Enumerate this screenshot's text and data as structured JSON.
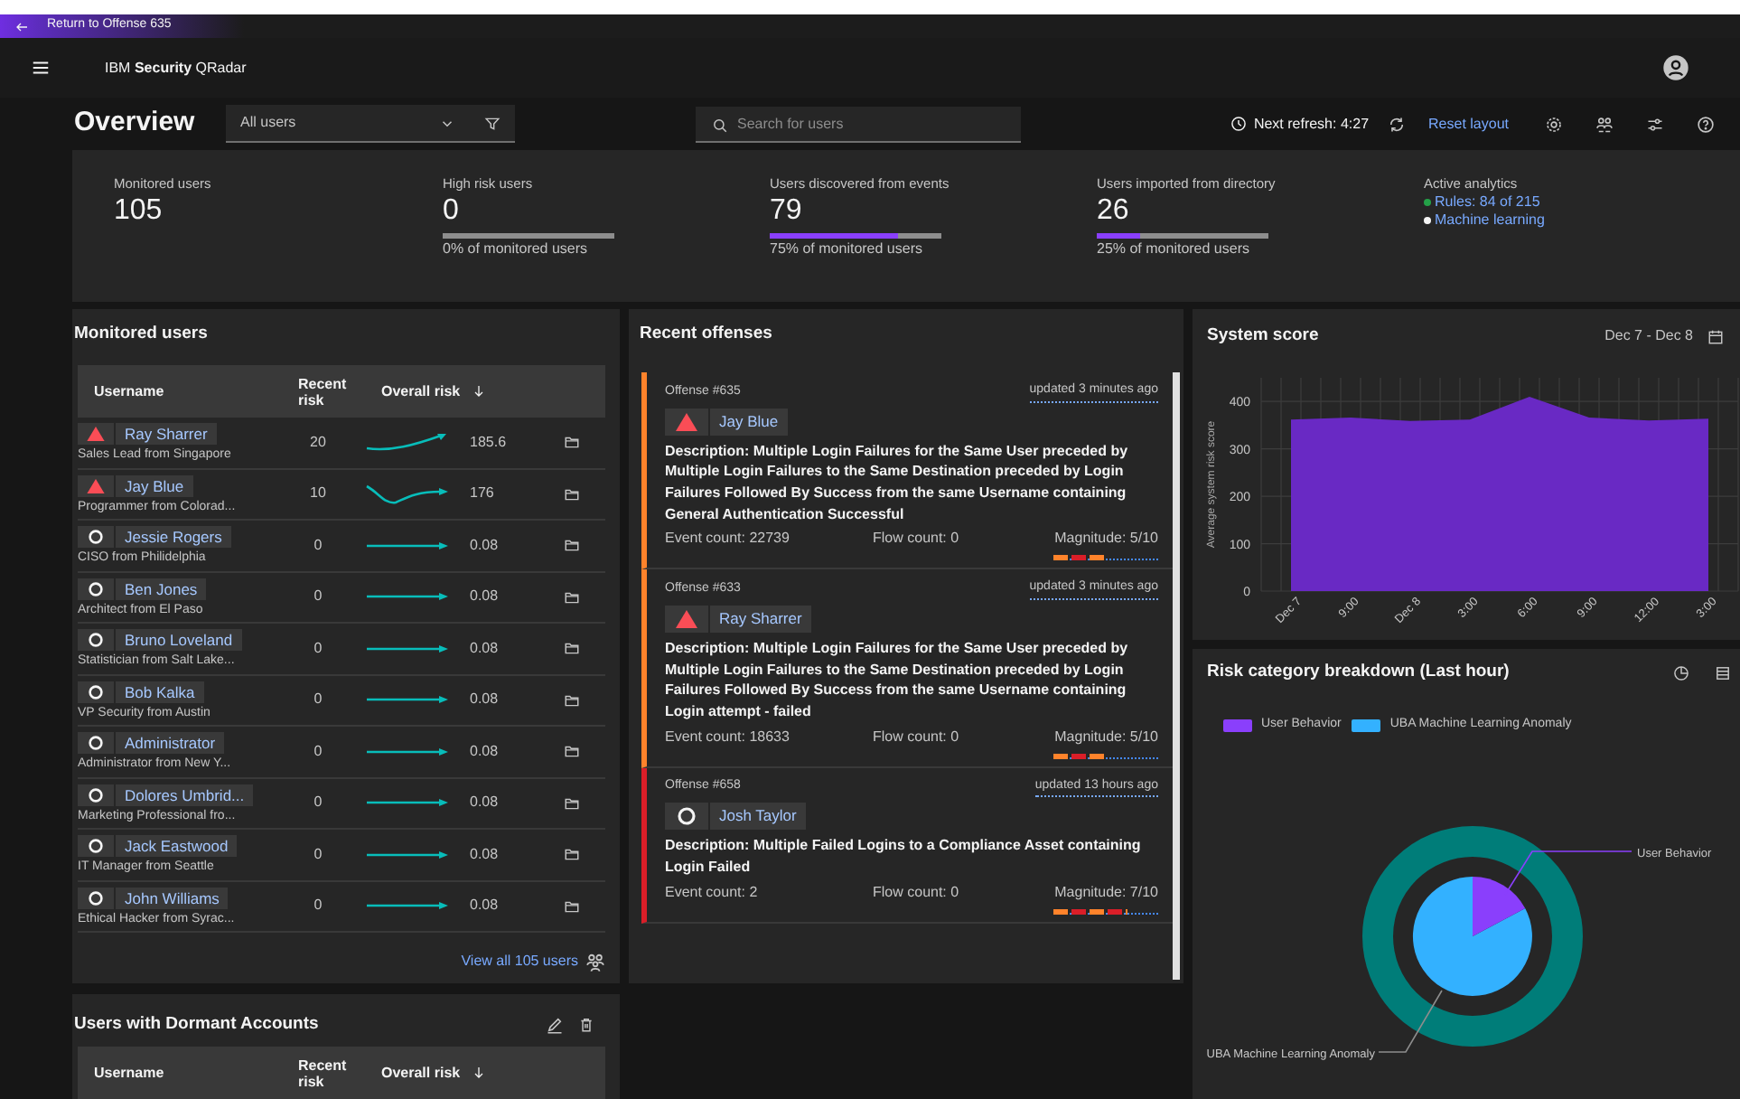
{
  "return_bar": {
    "label": "Return to Offense 635"
  },
  "header": {
    "title": "IBM **Security** QRadar"
  },
  "toolbar": {
    "title": "Overview",
    "filter": {
      "value": "All users"
    },
    "search": {
      "placeholder": "Search for users"
    },
    "refresh": "Next refresh: 4:27",
    "reset": "Reset layout"
  },
  "stats": [
    {
      "label": "Monitored users",
      "value": "105"
    },
    {
      "label": "High risk users",
      "value": "0",
      "caption": "0% of monitored users"
    },
    {
      "label": "Users discovered from events",
      "value": "79",
      "level": 0.75,
      "caption": "75% of monitored users"
    },
    {
      "label": "Users imported from directory",
      "value": "26",
      "level": 0.25,
      "caption": "25% of monitored users"
    }
  ],
  "analytics": {
    "label": "Active analytics",
    "items": [
      {
        "text": "Rules: 84 of 215",
        "color": "#24a148"
      },
      {
        "text": "Machine learning",
        "color": "#f4f4f4"
      }
    ]
  },
  "monitored": {
    "title": "Monitored users",
    "columns": [
      "Username",
      "Recent risk",
      "Overall risk"
    ],
    "rows": [
      {
        "name": "Ray Sharrer",
        "subtitle": "Sales Lead from Singapore",
        "high_risk": true,
        "recent": "20",
        "kind": "rise",
        "overall": "185.6"
      },
      {
        "name": "Jay Blue",
        "subtitle": "Programmer from Colorad...",
        "high_risk": true,
        "recent": "10",
        "kind": "dip",
        "overall": "176"
      },
      {
        "name": "Jessie Rogers",
        "subtitle": "CISO from Philidelphia",
        "high_risk": false,
        "recent": "0",
        "kind": "flat",
        "overall": "0.08"
      },
      {
        "name": "Ben Jones",
        "subtitle": "Architect from El Paso",
        "high_risk": false,
        "recent": "0",
        "kind": "flat",
        "overall": "0.08"
      },
      {
        "name": "Bruno Loveland",
        "subtitle": "Statistician from Salt Lake...",
        "high_risk": false,
        "recent": "0",
        "kind": "flat",
        "overall": "0.08"
      },
      {
        "name": "Bob Kalka",
        "subtitle": "VP Security from Austin",
        "high_risk": false,
        "recent": "0",
        "kind": "flat",
        "overall": "0.08"
      },
      {
        "name": "Administrator",
        "subtitle": "Administrator from New Y...",
        "high_risk": false,
        "recent": "0",
        "kind": "flat",
        "overall": "0.08"
      },
      {
        "name": "Dolores Umbrid...",
        "subtitle": "Marketing Professional fro...",
        "high_risk": false,
        "recent": "0",
        "kind": "flat",
        "overall": "0.08"
      },
      {
        "name": "Jack Eastwood",
        "subtitle": "IT Manager from Seattle",
        "high_risk": false,
        "recent": "0",
        "kind": "flat",
        "overall": "0.08"
      },
      {
        "name": "John Williams",
        "subtitle": "Ethical Hacker from Syrac...",
        "high_risk": false,
        "recent": "0",
        "kind": "flat",
        "overall": "0.08"
      }
    ],
    "view_all": "View all 105 users"
  },
  "dormant": {
    "title": "Users with Dormant Accounts",
    "columns": [
      "Username",
      "Recent risk",
      "Overall risk"
    ]
  },
  "offenses": {
    "title": "Recent offenses",
    "items": [
      {
        "id": "Offense #635",
        "updated": "updated 3 minutes ago",
        "high_risk": true,
        "user": "Jay Blue",
        "description": "Description: Multiple Login Failures for the Same User preceded by Multiple Login Failures to the Same Destination preceded by Login Failures Followed By Success from the same Username containing General Authentication Successful",
        "event_count": "Event count: 22739",
        "flow_count": "Flow count: 0",
        "magnitude": "Magnitude: 5/10",
        "level": 0.5,
        "color": "#ff832b"
      },
      {
        "id": "Offense #633",
        "updated": "updated 3 minutes ago",
        "high_risk": true,
        "user": "Ray Sharrer",
        "description": "Description: Multiple Login Failures for the Same User preceded by Multiple Login Failures to the Same Destination preceded by Login Failures Followed By Success from the same Username containing Login attempt - failed",
        "event_count": "Event count: 18633",
        "flow_count": "Flow count: 0",
        "magnitude": "Magnitude: 5/10",
        "level": 0.5,
        "color": "#ff832b"
      },
      {
        "id": "Offense #658",
        "updated": "updated 13 hours ago",
        "high_risk": false,
        "user": "Josh Taylor",
        "description": "Description: Multiple Failed Logins to a Compliance Asset containing Login Failed",
        "event_count": "Event count: 2",
        "flow_count": "Flow count: 0",
        "magnitude": "Magnitude: 7/10",
        "level": 0.7,
        "color": "#da1e28"
      }
    ]
  },
  "system_score": {
    "title": "System score",
    "range": "Dec 7 - Dec 8",
    "chart_data": {
      "type": "area",
      "ylabel": "Average system risk score",
      "categories": [
        "Dec 7",
        "9:00",
        "Dec 8",
        "3:00",
        "6:00",
        "9:00",
        "12:00",
        "3:00"
      ],
      "series": [
        {
          "color": "#6929c4",
          "values": [
            362,
            366,
            359,
            362,
            410,
            366,
            360,
            364
          ]
        }
      ],
      "ylim": [
        0,
        450
      ],
      "yticks": [
        0,
        100,
        200,
        300,
        400
      ],
      "grid": true
    }
  },
  "risk_breakdown": {
    "title": "Risk category breakdown (Last hour)",
    "legend": [
      {
        "label": "User Behavior",
        "color": "#8a3ffc"
      },
      {
        "label": "UBA Machine Learning Anomaly",
        "color": "#33b1ff"
      }
    ],
    "callouts": [
      "User Behavior",
      "UBA Machine Learning Anomaly"
    ]
  }
}
